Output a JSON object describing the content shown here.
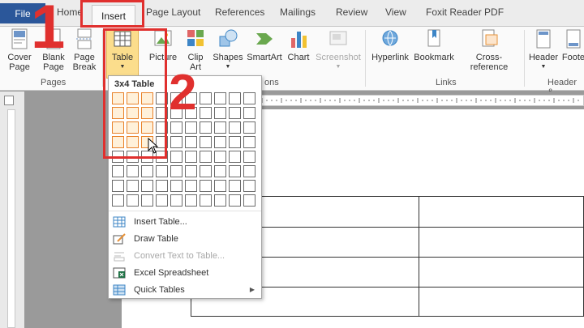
{
  "tabs": [
    "File",
    "Home",
    "Insert",
    "Page Layout",
    "References",
    "Mailings",
    "Review",
    "View",
    "Foxit Reader PDF"
  ],
  "ribbon": {
    "buttons": {
      "cover_page": "Cover Page",
      "blank_page": "Blank Page",
      "page_break": "Page Break",
      "table": "Table",
      "picture": "Picture",
      "clip_art": "Clip Art",
      "shapes": "Shapes",
      "smartart": "SmartArt",
      "chart": "Chart",
      "screenshot": "Screenshot",
      "hyperlink": "Hyperlink",
      "bookmark": "Bookmark",
      "cross_reference": "Cross-reference",
      "header": "Header",
      "footer": "Foote"
    },
    "groups": {
      "pages": "Pages",
      "illustrations": "ons",
      "links": "Links",
      "header_footer": "Header &"
    }
  },
  "dropdown": {
    "title": "3x4 Table",
    "grid": {
      "columns": 10,
      "rows": 8,
      "highlight_columns": 3,
      "highlight_rows": 4
    },
    "items": [
      {
        "label": "Insert Table...",
        "enabled": true,
        "icon": "insert-table-icon"
      },
      {
        "label": "Draw Table",
        "enabled": true,
        "icon": "draw-table-icon"
      },
      {
        "label": "Convert Text to Table...",
        "enabled": false,
        "icon": "convert-text-icon"
      },
      {
        "label": "Excel Spreadsheet",
        "enabled": true,
        "icon": "excel-icon"
      },
      {
        "label": "Quick Tables",
        "enabled": true,
        "icon": "quick-tables-icon",
        "submenu": true
      }
    ]
  },
  "annotations": {
    "step1": "1",
    "step2": "2",
    "color": "#e0302e"
  },
  "colors": {
    "file_tab": "#2b579a",
    "selection": "#e8822a",
    "table_button": "#fbdd8c"
  }
}
